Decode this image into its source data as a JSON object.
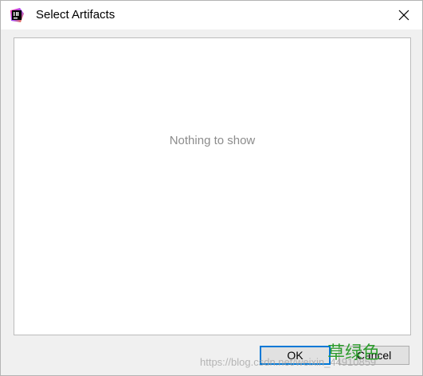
{
  "window": {
    "title": "Select Artifacts",
    "app_icon": "intellij-icon"
  },
  "panel": {
    "empty_text": "Nothing to show"
  },
  "buttons": {
    "ok_label": "OK",
    "cancel_label": "Cancel"
  },
  "overlay": {
    "url_watermark": "https://blog.csdn.net/weixin_44910859",
    "annotation": "草绿色"
  },
  "colors": {
    "focus_border": "#0078d7",
    "annotation_text": "#2e9d2e"
  }
}
